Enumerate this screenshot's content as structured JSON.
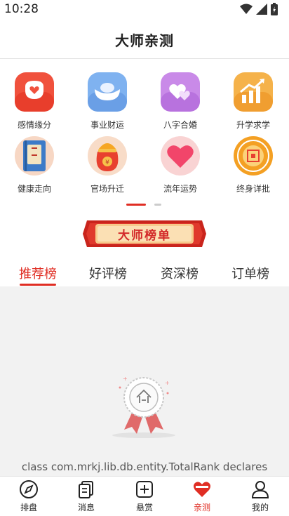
{
  "status_bar": {
    "time": "10:28"
  },
  "header": {
    "title": "大师亲测"
  },
  "grid": {
    "items": [
      {
        "label": "感情缘分",
        "icon": "love-lock-icon"
      },
      {
        "label": "事业财运",
        "icon": "gold-ingot-icon"
      },
      {
        "label": "八字合婚",
        "icon": "double-heart-icon"
      },
      {
        "label": "升学求学",
        "icon": "growth-chart-icon"
      },
      {
        "label": "健康走向",
        "icon": "health-book-icon"
      },
      {
        "label": "官场升迁",
        "icon": "money-bag-icon"
      },
      {
        "label": "流年运势",
        "icon": "heart-icon"
      },
      {
        "label": "终身详批",
        "icon": "longevity-coin-icon"
      }
    ]
  },
  "banner": {
    "label": "大师榜单"
  },
  "tabs": [
    {
      "label": "推荐榜",
      "active": true
    },
    {
      "label": "好评榜",
      "active": false
    },
    {
      "label": "资深榜",
      "active": false
    },
    {
      "label": "订单榜",
      "active": false
    }
  ],
  "content": {
    "empty_icon": "empty-badge-icon",
    "error_text": "class com.mrkj.lib.db.entity.TotalRank declares"
  },
  "bottom_nav": [
    {
      "label": "排盘",
      "icon": "compass-icon",
      "active": false
    },
    {
      "label": "消息",
      "icon": "message-icon",
      "active": false
    },
    {
      "label": "悬赏",
      "icon": "plus-box-icon",
      "active": false
    },
    {
      "label": "亲测",
      "icon": "heart-tab-icon",
      "active": true
    },
    {
      "label": "我的",
      "icon": "user-icon",
      "active": false
    }
  ],
  "colors": {
    "accent": "#e02e24",
    "banner_gold": "#f7c98b",
    "content_bg": "#f2f2f2"
  }
}
